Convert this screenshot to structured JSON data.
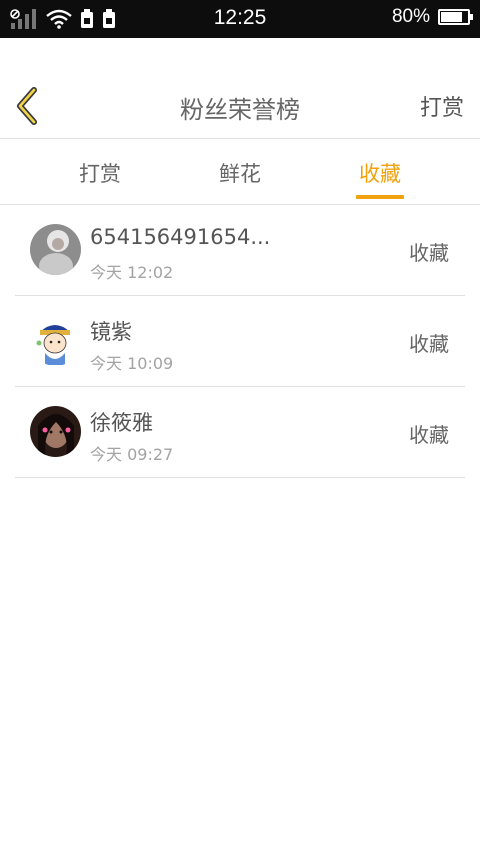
{
  "status_bar": {
    "time": "12:25",
    "battery_percent": "80%",
    "battery_level": 0.8
  },
  "header": {
    "title": "粉丝荣誉榜",
    "action_label": "打赏",
    "accent_color": "#f0a20f"
  },
  "tabs": [
    {
      "label": "打赏",
      "active": false
    },
    {
      "label": "鲜花",
      "active": false
    },
    {
      "label": "收藏",
      "active": true
    }
  ],
  "list": [
    {
      "name": "654156491654...",
      "time": "今天 12:02",
      "action": "收藏"
    },
    {
      "name": "镜紫",
      "time": "今天 10:09",
      "action": "收藏"
    },
    {
      "name": "徐筱雅",
      "time": "今天 09:27",
      "action": "收藏"
    }
  ]
}
